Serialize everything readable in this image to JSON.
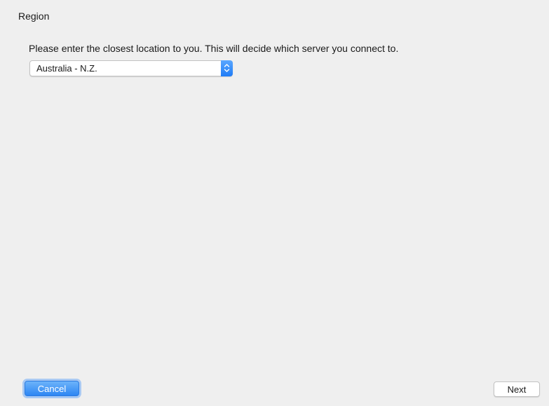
{
  "window": {
    "section_title": "Region"
  },
  "form": {
    "instruction": "Please enter the closest location to you. This will decide which server you connect to.",
    "region_select": {
      "selected_value": "Australia - N.Z."
    }
  },
  "buttons": {
    "cancel_label": "Cancel",
    "next_label": "Next"
  },
  "colors": {
    "accent": "#2d86f3",
    "background": "#efefef"
  },
  "icons": {
    "select_stepper": "chevron-up-down-icon"
  }
}
